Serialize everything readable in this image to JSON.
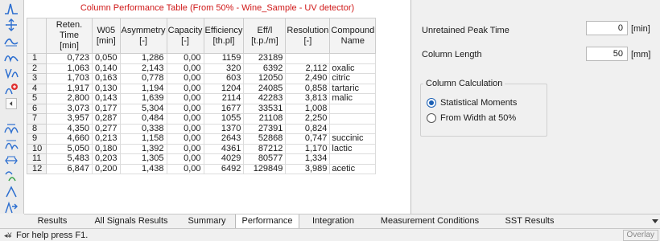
{
  "table": {
    "title": "Column Performance Table (From 50% - Wine_Sample - UV detector)",
    "headers": [
      {
        "l1": "",
        "l2": ""
      },
      {
        "l1": "Reten. Time",
        "l2": "[min]"
      },
      {
        "l1": "W05",
        "l2": "[min]"
      },
      {
        "l1": "Asymmetry",
        "l2": "[-]"
      },
      {
        "l1": "Capacity",
        "l2": "[-]"
      },
      {
        "l1": "Efficiency",
        "l2": "[th.pl]"
      },
      {
        "l1": "Eff/l",
        "l2": "[t.p./m]"
      },
      {
        "l1": "Resolution",
        "l2": "[-]"
      },
      {
        "l1": "Compound",
        "l2": "Name"
      }
    ],
    "rows": [
      [
        "1",
        "0,723",
        "0,050",
        "1,286",
        "0,00",
        "1159",
        "23189",
        "",
        ""
      ],
      [
        "2",
        "1,063",
        "0,140",
        "2,143",
        "0,00",
        "320",
        "6392",
        "2,112",
        "oxalic"
      ],
      [
        "3",
        "1,703",
        "0,163",
        "0,778",
        "0,00",
        "603",
        "12050",
        "2,490",
        "citric"
      ],
      [
        "4",
        "1,917",
        "0,130",
        "1,194",
        "0,00",
        "1204",
        "24085",
        "0,858",
        "tartaric"
      ],
      [
        "5",
        "2,800",
        "0,143",
        "1,639",
        "0,00",
        "2114",
        "42283",
        "3,813",
        "malic"
      ],
      [
        "6",
        "3,073",
        "0,177",
        "5,304",
        "0,00",
        "1677",
        "33531",
        "1,008",
        ""
      ],
      [
        "7",
        "3,957",
        "0,287",
        "0,484",
        "0,00",
        "1055",
        "21108",
        "2,250",
        ""
      ],
      [
        "8",
        "4,350",
        "0,277",
        "0,338",
        "0,00",
        "1370",
        "27391",
        "0,824",
        ""
      ],
      [
        "9",
        "4,660",
        "0,213",
        "1,158",
        "0,00",
        "2643",
        "52868",
        "0,747",
        "succinic"
      ],
      [
        "10",
        "5,050",
        "0,180",
        "1,392",
        "0,00",
        "4361",
        "87212",
        "1,170",
        "lactic"
      ],
      [
        "11",
        "5,483",
        "0,203",
        "1,305",
        "0,00",
        "4029",
        "80577",
        "1,334",
        ""
      ],
      [
        "12",
        "6,847",
        "0,200",
        "1,438",
        "0,00",
        "6492",
        "129849",
        "3,989",
        "acetic"
      ]
    ]
  },
  "settings": {
    "unretained_label": "Unretained Peak Time",
    "unretained_value": "0",
    "unretained_unit": "[min]",
    "length_label": "Column Length",
    "length_value": "50",
    "length_unit": "[mm]",
    "calc_title": "Column Calculation",
    "opt_stat": "Statistical Moments",
    "opt_width": "From Width at 50%"
  },
  "tabs": [
    "Results",
    "All Signals Results",
    "Summary",
    "Performance",
    "Integration",
    "Measurement Conditions",
    "SST Results"
  ],
  "status": {
    "text": "For help press F1.",
    "overlay": "Overlay"
  },
  "icons": [
    "peak-icon",
    "move-baseline-icon",
    "lock-baseline-icon",
    "valley-icon",
    "split-peak-icon",
    "add-peak-icon",
    "small-button-icon",
    "cross-peaks-icon",
    "tangent-icon",
    "merge-peaks-icon",
    "compare-icon",
    "negative-peak-icon",
    "single-peak-icon",
    "expand-icon"
  ],
  "colors": {
    "title_red": "#d01818",
    "icon_blue": "#2d6fd0",
    "accent": "#1a5fb4"
  }
}
